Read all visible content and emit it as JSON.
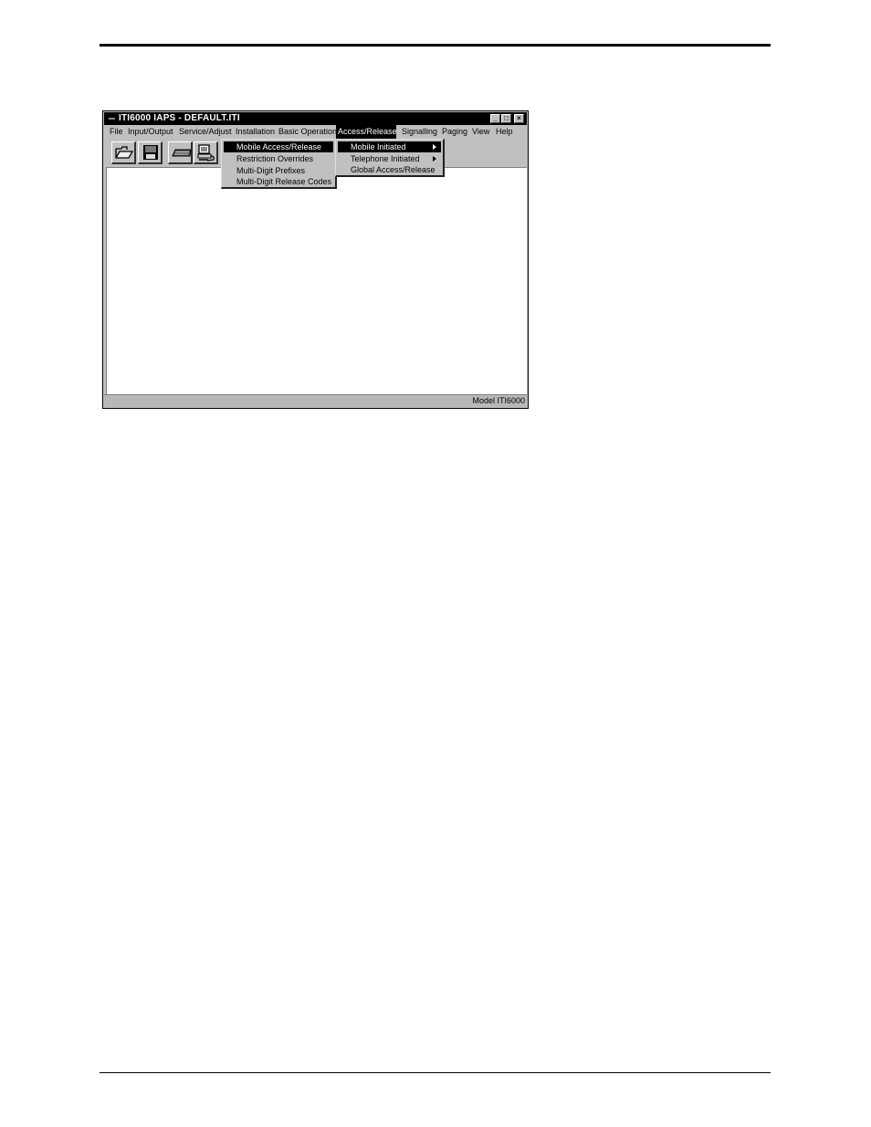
{
  "window": {
    "title": "ITI6000 IAPS - DEFAULT.ITI",
    "controls": {
      "minimize": "_",
      "maximize": "□",
      "close": "×"
    }
  },
  "menubar": {
    "items": [
      "File",
      "Input/Output",
      "Service/Adjust",
      "Installation",
      "Basic Operation",
      "Access/Release",
      "Signalling",
      "Paging",
      "View",
      "Help"
    ],
    "active": "Access/Release"
  },
  "toolbar": {
    "icons": [
      "open-folder-icon",
      "save-disk-icon",
      "keyboard-icon",
      "computer-icon"
    ]
  },
  "menu_access_release": {
    "items": [
      "Mobile Access/Release",
      "Restriction Overrides",
      "Multi-Digit Prefixes",
      "Multi-Digit Release Codes"
    ],
    "highlighted": "Mobile Access/Release"
  },
  "submenu_mobile": {
    "items": [
      "Mobile Initiated",
      "Telephone Initiated",
      "Global Access/Release"
    ],
    "highlighted": "Mobile Initiated"
  },
  "statusbar": {
    "text": "Model ITI6000"
  },
  "colors": {
    "titlebar": "#000000",
    "chrome": "#c0c0c0",
    "highlight": "#000000"
  }
}
